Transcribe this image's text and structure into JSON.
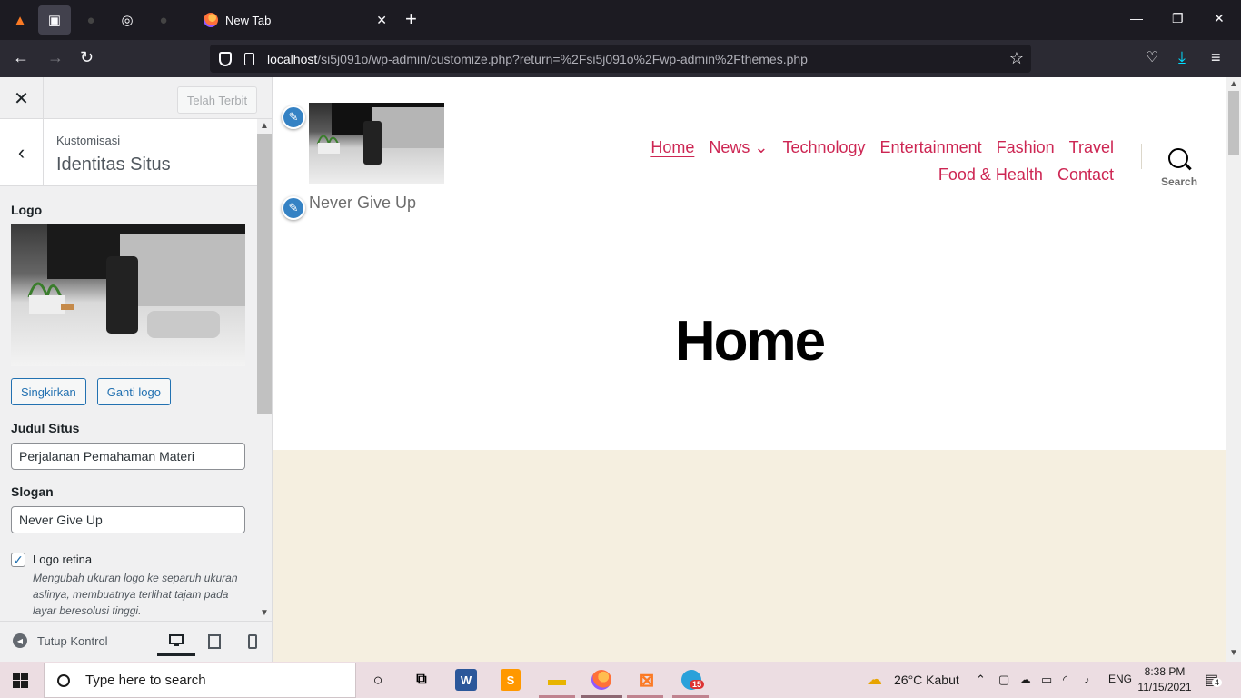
{
  "browser": {
    "tab_title": "New Tab",
    "url_host": "localhost",
    "url_path": "/si5j091o/wp-admin/customize.php?return=%2Fsi5j091o%2Fwp-admin%2Fthemes.php"
  },
  "customizer": {
    "publish_label": "Telah Terbit",
    "breadcrumb": "Kustomisasi",
    "section_title": "Identitas Situs",
    "logo_label": "Logo",
    "remove_button": "Singkirkan",
    "change_logo_button": "Ganti logo",
    "site_title_label": "Judul Situs",
    "site_title_value": "Perjalanan Pemahaman Materi",
    "tagline_label": "Slogan",
    "tagline_value": "Never Give Up",
    "retina_label": "Logo retina",
    "retina_checked": true,
    "retina_description": "Mengubah ukuran logo ke separuh ukuran aslinya, membuatnya terlihat tajam pada layar beresolusi tinggi.",
    "collapse_label": "Tutup Kontrol"
  },
  "site": {
    "tagline": "Never Give Up",
    "menu": [
      "Home",
      "News",
      "Technology",
      "Entertainment",
      "Fashion",
      "Travel",
      "Food & Health",
      "Contact"
    ],
    "search_label": "Search",
    "page_title": "Home"
  },
  "taskbar": {
    "search_placeholder": "Type here to search",
    "weather": "26°C  Kabut",
    "language": "ENG",
    "time": "8:38 PM",
    "date": "11/15/2021",
    "telegram_badge": "15",
    "notifications": "4"
  }
}
